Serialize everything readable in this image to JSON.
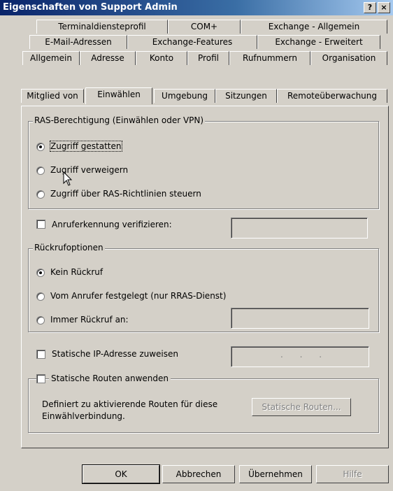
{
  "window": {
    "title": "Eigenschaften von Support Admin",
    "help_button": "?",
    "close_button": "×"
  },
  "tabs": {
    "row1": [
      "Terminaldiensteprofil",
      "COM+",
      "Exchange - Allgemein"
    ],
    "row2": [
      "E-Mail-Adressen",
      "Exchange-Features",
      "Exchange - Erweitert"
    ],
    "row3": [
      "Allgemein",
      "Adresse",
      "Konto",
      "Profil",
      "Rufnummern",
      "Organisation"
    ],
    "row4": [
      "Mitglied von",
      "Einwählen",
      "Umgebung",
      "Sitzungen",
      "Remoteüberwachung"
    ],
    "active": "Einwählen"
  },
  "ras": {
    "legend": "RAS-Berechtigung (Einwählen oder VPN)",
    "options": [
      "Zugriff gestatten",
      "Zugriff verweigern",
      "Zugriff über RAS-Richtlinien steuern"
    ],
    "selected": "Zugriff gestatten"
  },
  "caller_id": {
    "label": "Anruferkennung verifizieren:",
    "checked": false,
    "value": ""
  },
  "callback": {
    "legend": "Rückrufoptionen",
    "options": [
      "Kein Rückruf",
      "Vom Anrufer festgelegt (nur RRAS-Dienst)",
      "Immer Rückruf an:"
    ],
    "selected": "Kein Rückruf",
    "number_value": ""
  },
  "static_ip": {
    "label": "Statische IP-Adresse zuweisen",
    "checked": false,
    "dots": ". . ."
  },
  "static_routes": {
    "label": "Statische Routen anwenden",
    "checked": false,
    "description_line1": "Definiert zu aktivierende Routen für diese",
    "description_line2": "Einwählverbindung.",
    "button": "Statische Routen..."
  },
  "buttons": {
    "ok": "OK",
    "cancel": "Abbrechen",
    "apply": "Übernehmen",
    "help": "Hilfe"
  }
}
